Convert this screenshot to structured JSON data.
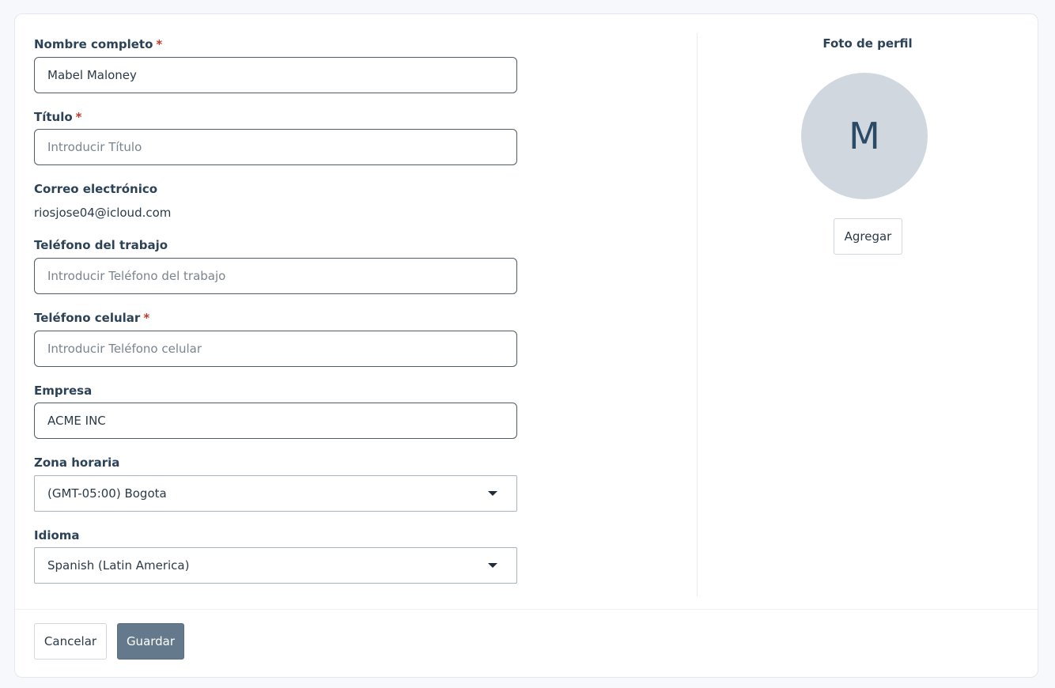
{
  "form": {
    "full_name": {
      "label": "Nombre completo",
      "required_mark": "*",
      "value": "Mabel Maloney",
      "placeholder": ""
    },
    "title": {
      "label": "Título",
      "required_mark": "*",
      "value": "",
      "placeholder": "Introducir Título"
    },
    "email": {
      "label": "Correo electrónico",
      "value": "riosjose04@icloud.com"
    },
    "work_phone": {
      "label": "Teléfono del trabajo",
      "value": "",
      "placeholder": "Introducir Teléfono del trabajo"
    },
    "mobile_phone": {
      "label": "Teléfono celular",
      "required_mark": "*",
      "value": "",
      "placeholder": "Introducir Teléfono celular"
    },
    "company": {
      "label": "Empresa",
      "value": "ACME INC",
      "placeholder": ""
    },
    "timezone": {
      "label": "Zona horaria",
      "selected": "(GMT-05:00) Bogota",
      "icon": "chevron-down-icon"
    },
    "language": {
      "label": "Idioma",
      "selected": "Spanish (Latin America)",
      "icon": "chevron-down-icon"
    }
  },
  "profile_photo": {
    "title": "Foto de perfil",
    "avatar_initial": "M",
    "add_label": "Agregar"
  },
  "footer": {
    "cancel_label": "Cancelar",
    "save_label": "Guardar"
  },
  "colors": {
    "required": "#c0392b",
    "primary_button": "#64798b",
    "avatar_bg": "#d0d7df",
    "label_text": "#2b4257"
  }
}
